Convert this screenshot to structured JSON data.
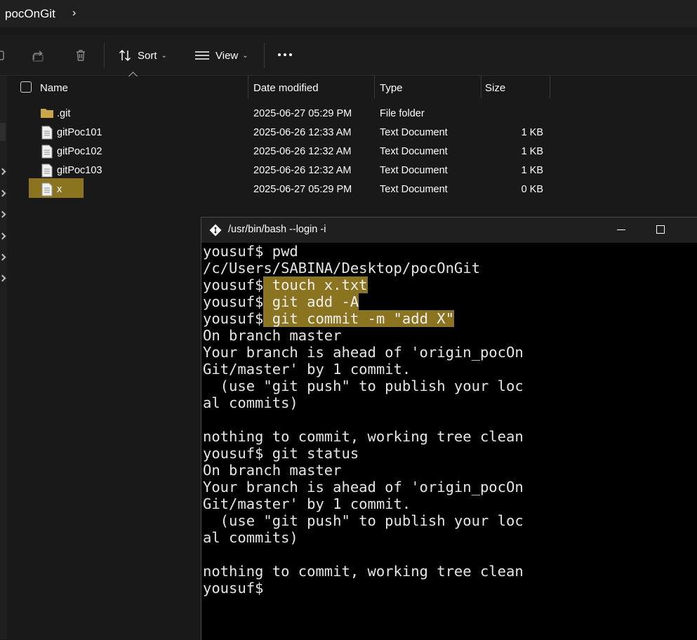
{
  "explorer": {
    "breadcrumb": "pocOnGit",
    "toolbar": {
      "sort_label": "Sort",
      "view_label": "View"
    },
    "columns": {
      "name": "Name",
      "date": "Date modified",
      "type": "Type",
      "size": "Size"
    },
    "files": [
      {
        "name": ".git",
        "date": "2025-06-27 05:29 PM",
        "type": "File folder",
        "size": "",
        "icon": "folder-icon"
      },
      {
        "name": "gitPoc101",
        "date": "2025-06-26 12:33 AM",
        "type": "Text Document",
        "size": "1 KB",
        "icon": "text-file-icon"
      },
      {
        "name": "gitPoc102",
        "date": "2025-06-26 12:32 AM",
        "type": "Text Document",
        "size": "1 KB",
        "icon": "text-file-icon"
      },
      {
        "name": "gitPoc103",
        "date": "2025-06-26 12:32 AM",
        "type": "Text Document",
        "size": "1 KB",
        "icon": "text-file-icon"
      },
      {
        "name": "x",
        "date": "2025-06-27 05:29 PM",
        "type": "Text Document",
        "size": "0 KB",
        "icon": "text-file-icon"
      }
    ]
  },
  "terminal": {
    "title": "/usr/bin/bash --login -i",
    "lines": [
      {
        "prompt": "yousuf$",
        "cmd": " pwd"
      },
      {
        "text": "/c/Users/SABINA/Desktop/pocOnGit"
      },
      {
        "prompt": "yousuf$",
        "cmd": " touch x.txt"
      },
      {
        "prompt": "yousuf$",
        "cmd": " git add -A"
      },
      {
        "prompt": "yousuf$",
        "cmd": " git commit -m \"add X\""
      },
      {
        "text": "On branch master"
      },
      {
        "text": "Your branch is ahead of 'origin_pocOn"
      },
      {
        "text": "Git/master' by 1 commit."
      },
      {
        "text": "  (use \"git push\" to publish your loc"
      },
      {
        "text": "al commits)"
      },
      {
        "text": ""
      },
      {
        "text": "nothing to commit, working tree clean"
      },
      {
        "prompt": "yousuf$",
        "cmd": " git status"
      },
      {
        "text": "On branch master"
      },
      {
        "text": "Your branch is ahead of 'origin_pocOn"
      },
      {
        "text": "Git/master' by 1 commit."
      },
      {
        "text": "  (use \"git push\" to publish your loc"
      },
      {
        "text": "al commits)"
      },
      {
        "text": ""
      },
      {
        "text": "nothing to commit, working tree clean"
      },
      {
        "prompt": "yousuf$",
        "cmd": ""
      }
    ]
  },
  "colors": {
    "highlight": "#8a7420",
    "folder": "#c9a646",
    "terminal_bg": "#000000"
  }
}
